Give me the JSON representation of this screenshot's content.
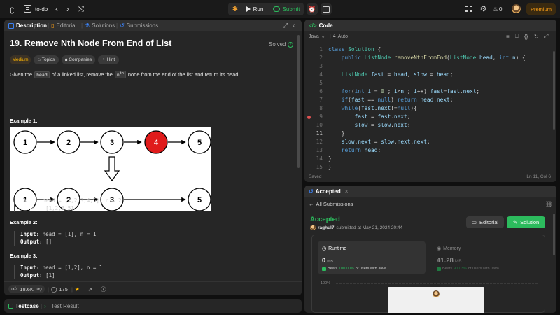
{
  "topbar": {
    "problem_list_label": "to-do",
    "run_label": "Run",
    "submit_label": "Submit",
    "streak_count": "0",
    "premium_label": "Premium"
  },
  "description_panel": {
    "tabs": [
      {
        "label": "Description"
      },
      {
        "label": "Editorial"
      },
      {
        "label": "Solutions"
      },
      {
        "label": "Submissions"
      }
    ],
    "title": "19. Remove Nth Node From End of List",
    "solved_label": "Solved",
    "difficulty": "Medium",
    "topics_label": "Topics",
    "companies_label": "Companies",
    "hint_label": "Hint",
    "statement": {
      "part1": "Given the",
      "code1": "head",
      "part2": "of a linked list, remove the",
      "code2": "n",
      "sup": "th",
      "part3": "node from the end of the list and return its head."
    },
    "diagram": {
      "top_nodes": [
        "1",
        "2",
        "3",
        "4",
        "5"
      ],
      "bottom_nodes": [
        "1",
        "2",
        "3",
        "5"
      ],
      "highlight_color": "#e01b1b"
    },
    "examples": [
      {
        "title": "Example 1:",
        "input_label": "Input:",
        "input": "head = [1,2,3,4,5], n = 2",
        "output_label": "Output:",
        "output": "[1,2,3,5]"
      },
      {
        "title": "Example 2:",
        "input_label": "Input:",
        "input": "head = [1], n = 1",
        "output_label": "Output:",
        "output": "[]"
      },
      {
        "title": "Example 3:",
        "input_label": "Input:",
        "input": "head = [1,2], n = 1",
        "output_label": "Output:",
        "output": "[1]"
      }
    ],
    "footer": {
      "likes": "18.6K",
      "comments": "175"
    }
  },
  "testcase_panel": {
    "tab1": "Testcase",
    "tab2": "Test Result"
  },
  "code_panel": {
    "title": "Code",
    "language": "Java",
    "mode": "Auto",
    "status": "Saved",
    "cursor": "Ln 11, Col 6",
    "active_line": "11",
    "line_numbers": [
      "1",
      "2",
      "3",
      "4",
      "5",
      "6",
      "7",
      "8",
      "9",
      "10",
      "11",
      "12",
      "13",
      "14",
      "15"
    ]
  },
  "result_panel": {
    "tab_label": "Accepted",
    "back_label": "All Submissions",
    "status": "Accepted",
    "username": "raghul7",
    "submitted": "submitted at May 21, 2024 20:44",
    "editorial_btn": "Editorial",
    "solution_btn": "Solution",
    "runtime": {
      "title": "Runtime",
      "value": "0",
      "unit": "ms",
      "beats_label": "Beats",
      "beats_pct": "100.00%",
      "beats_suffix": "of users with Java"
    },
    "memory": {
      "title": "Memory",
      "value": "41.28",
      "unit": "MB",
      "beats_label": "Beats",
      "beats_pct": "90.03%",
      "beats_suffix": "of users with Java"
    },
    "pct_label": "100%"
  },
  "colors": {
    "accent_green": "#2cbb5d",
    "brand_orange": "#ffa116",
    "medium_yellow": "#ffb800"
  }
}
